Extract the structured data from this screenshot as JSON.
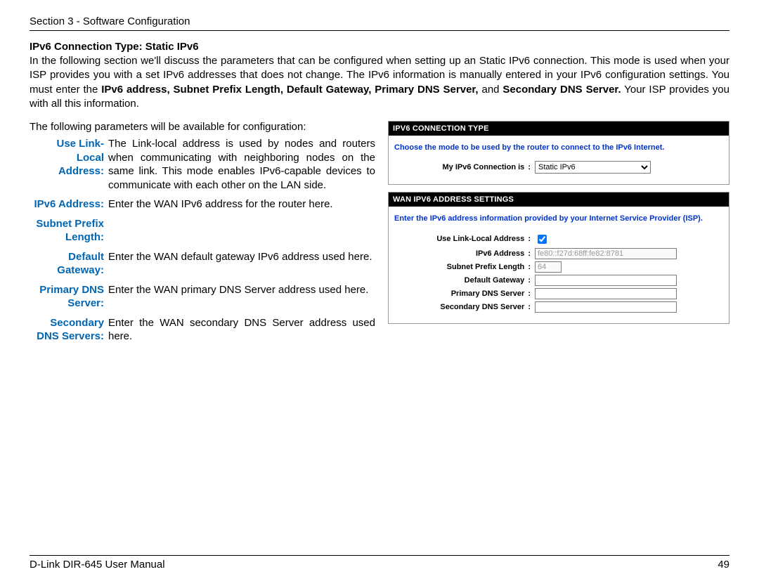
{
  "header": "Section 3 - Software Configuration",
  "title": "IPv6 Connection Type: Static IPv6",
  "intro_parts": {
    "p1": "In the following section we'll discuss the parameters that can be configured when setting up an Static IPv6 connection. This mode is used when your ISP provides you with a set IPv6 addresses that does not change. The IPv6 information is manually entered in your IPv6 configuration settings. You must enter the ",
    "bold1": "IPv6 address, Subnet Prefix Length, Default Gateway, Primary DNS Server,",
    "mid": " and ",
    "bold2": "Secondary DNS Server.",
    "p2": " Your ISP provides you with all this information."
  },
  "params_intro": "The following parameters will be available for configuration:",
  "defs": [
    {
      "label": "Use Link-Local Address:",
      "value": "The Link-local address is used by nodes and routers when communicating with neighboring nodes on the same link. This mode enables IPv6-capable devices to communicate with each other on the LAN side."
    },
    {
      "label": "IPv6 Address:",
      "value": "Enter the WAN IPv6 address for the router here."
    },
    {
      "label": "Subnet Prefix Length:",
      "value": ""
    },
    {
      "label": "Default Gateway:",
      "value": "Enter the WAN default gateway IPv6 address used here."
    },
    {
      "label": "Primary DNS Server:",
      "value": "Enter the WAN primary DNS Server address used here."
    },
    {
      "label": "Secondary DNS Servers:",
      "value": "Enter the WAN secondary DNS Server address used here."
    }
  ],
  "panel1": {
    "header": "IPV6 CONNECTION TYPE",
    "note": "Choose the mode to be used by the router to connect to the IPv6 Internet.",
    "row_label": "My IPv6 Connection is",
    "select_value": "Static IPv6"
  },
  "panel2": {
    "header": "WAN IPV6 ADDRESS SETTINGS",
    "note": "Enter the IPv6 address information provided by your Internet Service Provider (ISP).",
    "rows": {
      "use_link_local": "Use Link-Local Address",
      "ipv6_address": "IPv6 Address",
      "ipv6_address_value": "fe80::f27d:68ff:fe82:8781",
      "subnet_prefix": "Subnet Prefix Length",
      "subnet_prefix_value": "64",
      "default_gateway": "Default Gateway",
      "primary_dns": "Primary DNS Server",
      "secondary_dns": "Secondary DNS Server"
    }
  },
  "footer_left": "D-Link DIR-645 User Manual",
  "footer_right": "49"
}
